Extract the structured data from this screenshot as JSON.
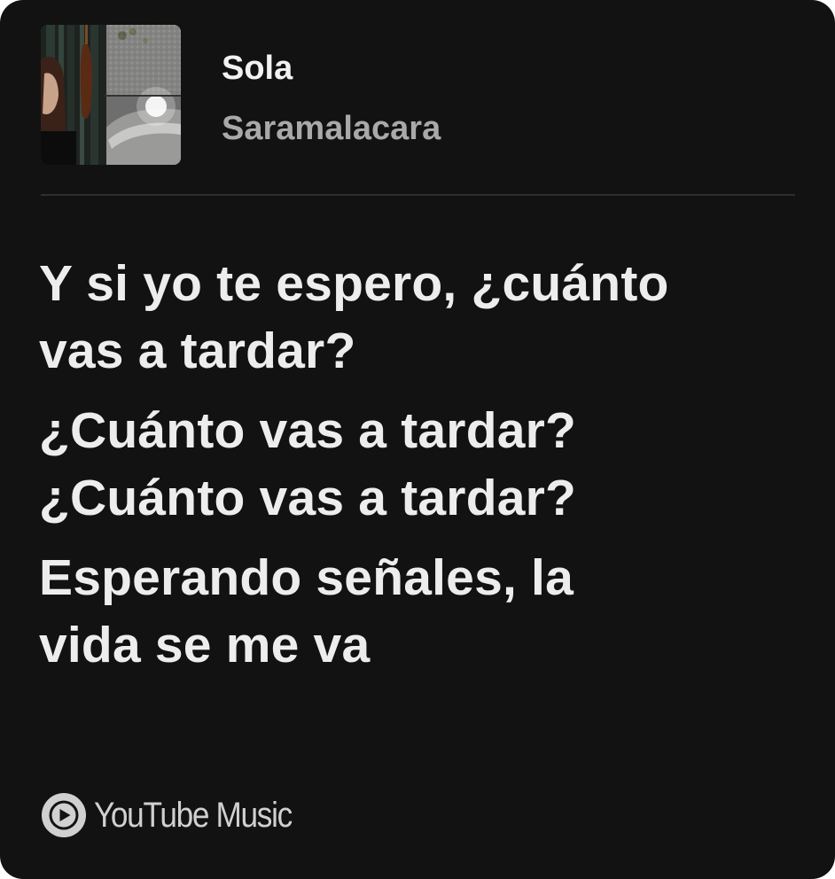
{
  "track": {
    "title": "Sola",
    "artist": "Saramalacara",
    "artwork_icon": "album-artwork-image"
  },
  "lyrics": {
    "stanzas": [
      [
        "Y si yo te espero, ¿cuánto",
        "vas a tardar?"
      ],
      [
        "¿Cuánto vas a tardar?",
        "¿Cuánto vas a tardar?"
      ],
      [
        "Esperando señales, la",
        "vida se me va"
      ]
    ]
  },
  "footer": {
    "brand_icon": "youtube-music-play-icon",
    "brand_label": "YouTube Music"
  },
  "colors": {
    "card_background": "#121212",
    "title_text": "#f2f2f2",
    "artist_text": "#a9a9a9",
    "lyrics_text": "#ededed",
    "brand_text": "#d0d0d0"
  }
}
